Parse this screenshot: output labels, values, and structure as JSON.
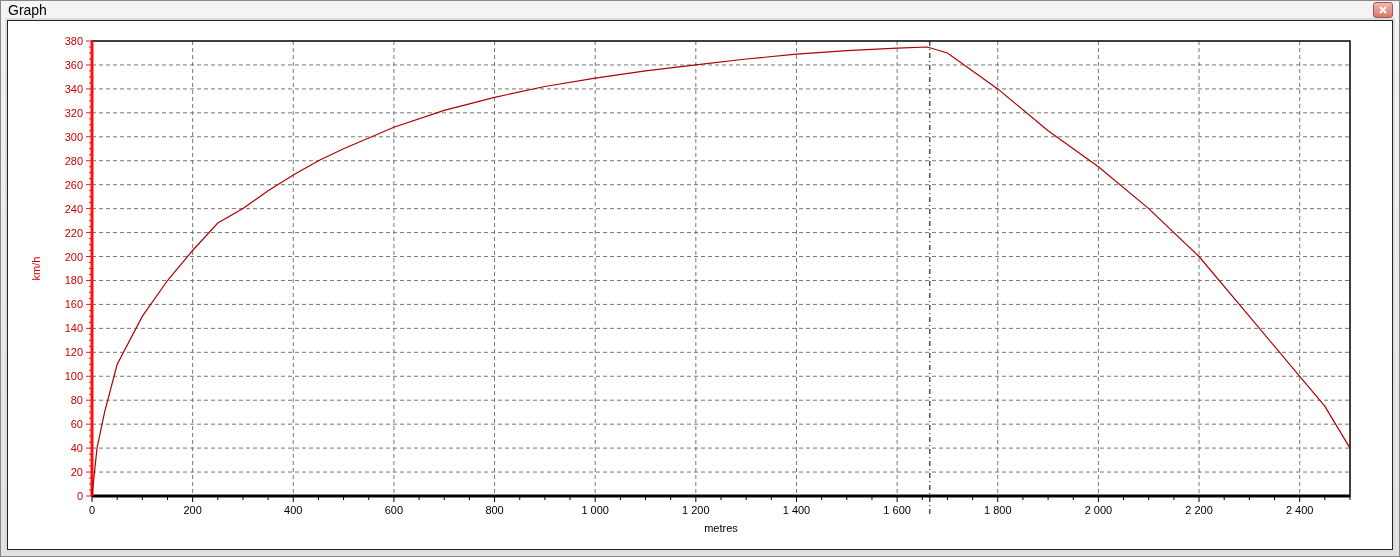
{
  "window": {
    "title": "Graph"
  },
  "chart": {
    "chart_data": {
      "type": "line",
      "xlabel": "metres",
      "ylabel": "km/h",
      "xlim": [
        0,
        2500
      ],
      "ylim": [
        0,
        380
      ],
      "xticks": [
        {
          "value": 0,
          "label": "0"
        },
        {
          "value": 200,
          "label": "200"
        },
        {
          "value": 400,
          "label": "400"
        },
        {
          "value": 600,
          "label": "600"
        },
        {
          "value": 800,
          "label": "800"
        },
        {
          "value": 1000,
          "label": "1 000"
        },
        {
          "value": 1200,
          "label": "1 200"
        },
        {
          "value": 1400,
          "label": "1 400"
        },
        {
          "value": 1600,
          "label": "1 600"
        },
        {
          "value": 1800,
          "label": "1 800"
        },
        {
          "value": 2000,
          "label": "2 000"
        },
        {
          "value": 2200,
          "label": "2 200"
        },
        {
          "value": 2400,
          "label": "2 400"
        }
      ],
      "yticks": [
        0,
        20,
        40,
        60,
        80,
        100,
        120,
        140,
        160,
        180,
        200,
        220,
        240,
        260,
        280,
        300,
        320,
        340,
        360,
        380
      ],
      "x": [
        0,
        10,
        25,
        50,
        100,
        150,
        200,
        250,
        300,
        350,
        400,
        450,
        500,
        600,
        700,
        800,
        900,
        1000,
        1100,
        1200,
        1300,
        1400,
        1500,
        1600,
        1660,
        1700,
        1800,
        1900,
        2000,
        2100,
        2200,
        2300,
        2400,
        2450,
        2500
      ],
      "grid": true,
      "series": [
        {
          "color": "#b00000",
          "values": [
            0,
            40,
            70,
            110,
            150,
            180,
            205,
            228,
            240,
            255,
            268,
            280,
            290,
            308,
            322,
            333,
            342,
            349,
            355,
            360,
            365,
            369,
            372,
            374,
            375,
            370,
            340,
            305,
            275,
            240,
            200,
            150,
            100,
            75,
            40
          ]
        }
      ],
      "ref_lines": [
        {
          "axis": "x",
          "value": 1665
        }
      ]
    }
  }
}
